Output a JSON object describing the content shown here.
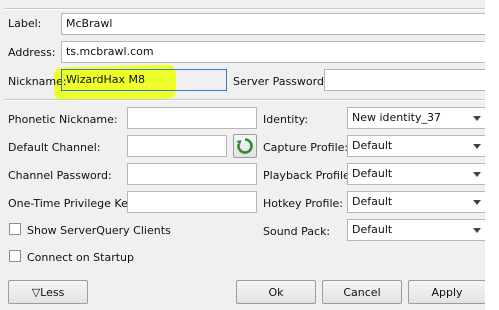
{
  "labels": {
    "label": "Label:",
    "address": "Address:",
    "nickname": "Nickname:",
    "server_password": "Server Password:",
    "phonetic_nickname": "Phonetic Nickname:",
    "default_channel": "Default Channel:",
    "channel_password": "Channel Password:",
    "privilege_key": "One-Time Privilege Key:",
    "identity": "Identity:",
    "capture_profile": "Capture Profile:",
    "playback_profile": "Playback Profile:",
    "hotkey_profile": "Hotkey Profile:",
    "sound_pack": "Sound Pack:"
  },
  "values": {
    "label": "McBrawl",
    "address": "ts.mcbrawl.com",
    "nickname": "WizardHax M8",
    "server_password": "",
    "phonetic_nickname": "",
    "default_channel": "",
    "channel_password": "",
    "privilege_key": ""
  },
  "selects": {
    "identity": "New identity_37",
    "capture_profile": "Default",
    "playback_profile": "Default",
    "hotkey_profile": "Default",
    "sound_pack": "Default"
  },
  "checkboxes": {
    "show_serverquery": {
      "label": "Show ServerQuery Clients",
      "checked": false
    },
    "connect_on_startup": {
      "label": "Connect on Startup",
      "checked": false
    }
  },
  "buttons": {
    "less": "▽Less",
    "ok": "Ok",
    "cancel": "Cancel",
    "apply": "Apply"
  },
  "annotation": {
    "highlight_color": "#eeff1a"
  },
  "icons": {
    "refresh": "refresh-icon"
  }
}
